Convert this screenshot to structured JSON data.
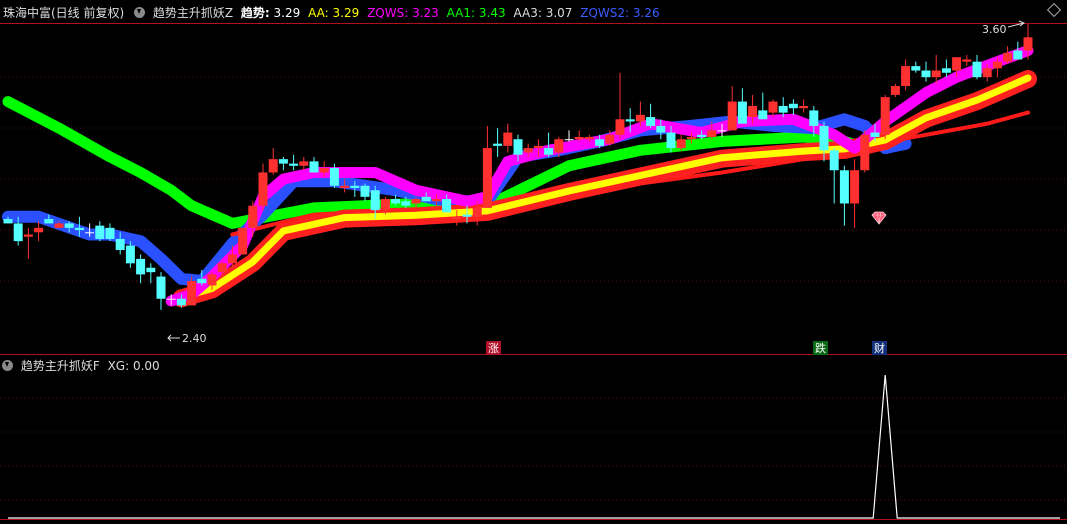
{
  "header": {
    "title": "珠海中富(日线 前复权)",
    "indicator": "趋势主升抓妖Z",
    "values": [
      {
        "label": "趋势:",
        "value": "3.29",
        "color": "#ffffff"
      },
      {
        "label": "AA:",
        "value": "3.29",
        "color": "#ffff00"
      },
      {
        "label": "ZQWS:",
        "value": "3.23",
        "color": "#ff00ff"
      },
      {
        "label": "AA1:",
        "value": "3.43",
        "color": "#00ff00"
      },
      {
        "label": "AA3:",
        "value": "3.07",
        "color": "#dddddd"
      },
      {
        "label": "ZQWS2:",
        "value": "3.26",
        "color": "#3a5cff"
      }
    ]
  },
  "lower": {
    "indicator": "趋势主升抓妖F",
    "value_label": "XG:",
    "value": "0.00"
  },
  "annotations": {
    "high": "3.60",
    "low": "2.40",
    "signals": [
      {
        "text": "涨",
        "bg": "#b0102a"
      },
      {
        "text": "跌",
        "bg": "#0c6a16"
      },
      {
        "text": "财",
        "bg": "#12307a"
      }
    ]
  },
  "chart_data": {
    "type": "candlestick",
    "price_range": [
      2.33,
      3.72
    ],
    "colors": {
      "up": "#ff3030",
      "down": "#54ffff",
      "flat": "#ffffff"
    },
    "candles": [
      [
        2.84,
        2.85,
        2.84,
        2.82
      ],
      [
        2.82,
        2.85,
        2.72,
        2.74
      ],
      [
        2.76,
        2.8,
        2.66,
        2.77
      ],
      [
        2.78,
        2.83,
        2.74,
        2.8
      ],
      [
        2.84,
        2.86,
        2.83,
        2.82
      ],
      [
        2.8,
        2.83,
        2.8,
        2.82
      ],
      [
        2.82,
        2.83,
        2.78,
        2.8
      ],
      [
        2.8,
        2.85,
        2.76,
        2.79
      ],
      [
        2.78,
        2.82,
        2.76,
        2.78
      ],
      [
        2.81,
        2.83,
        2.74,
        2.75
      ],
      [
        2.8,
        2.82,
        2.74,
        2.75
      ],
      [
        2.75,
        2.78,
        2.68,
        2.7
      ],
      [
        2.72,
        2.74,
        2.62,
        2.64
      ],
      [
        2.66,
        2.68,
        2.55,
        2.59
      ],
      [
        2.62,
        2.64,
        2.55,
        2.6
      ],
      [
        2.58,
        2.6,
        2.43,
        2.48
      ],
      [
        2.48,
        2.5,
        2.45,
        2.48
      ],
      [
        2.48,
        2.5,
        2.44,
        2.45
      ],
      [
        2.45,
        2.58,
        2.45,
        2.56
      ],
      [
        2.57,
        2.61,
        2.54,
        2.55
      ],
      [
        2.54,
        2.6,
        2.52,
        2.59
      ],
      [
        2.6,
        2.65,
        2.58,
        2.64
      ],
      [
        2.64,
        2.72,
        2.62,
        2.68
      ],
      [
        2.68,
        2.8,
        2.68,
        2.8
      ],
      [
        2.8,
        2.92,
        2.76,
        2.9
      ],
      [
        2.9,
        3.09,
        2.88,
        3.05
      ],
      [
        3.05,
        3.16,
        3.04,
        3.11
      ],
      [
        3.11,
        3.12,
        3.06,
        3.09
      ],
      [
        3.09,
        3.13,
        3.06,
        3.08
      ],
      [
        3.08,
        3.12,
        3.06,
        3.1
      ],
      [
        3.1,
        3.12,
        3.05,
        3.05
      ],
      [
        3.05,
        3.1,
        3.03,
        3.07
      ],
      [
        3.07,
        3.09,
        2.98,
        2.99
      ],
      [
        2.98,
        3.02,
        2.96,
        2.99
      ],
      [
        2.99,
        3.01,
        2.94,
        2.98
      ],
      [
        2.99,
        3.0,
        2.92,
        2.94
      ],
      [
        2.97,
        2.99,
        2.84,
        2.88
      ],
      [
        2.88,
        2.94,
        2.86,
        2.93
      ],
      [
        2.93,
        2.95,
        2.9,
        2.91
      ],
      [
        2.92,
        2.94,
        2.89,
        2.9
      ],
      [
        2.91,
        2.94,
        2.89,
        2.93
      ],
      [
        2.94,
        2.96,
        2.92,
        2.92
      ],
      [
        2.92,
        2.95,
        2.9,
        2.93
      ],
      [
        2.93,
        2.95,
        2.87,
        2.87
      ],
      [
        2.84,
        2.88,
        2.81,
        2.85
      ],
      [
        2.86,
        2.9,
        2.82,
        2.85
      ],
      [
        2.85,
        2.92,
        2.81,
        2.89
      ],
      [
        2.89,
        3.26,
        2.89,
        3.16
      ],
      [
        3.18,
        3.25,
        3.12,
        3.17
      ],
      [
        3.17,
        3.27,
        3.14,
        3.23
      ],
      [
        3.2,
        3.22,
        3.1,
        3.13
      ],
      [
        3.14,
        3.18,
        3.12,
        3.16
      ],
      [
        3.16,
        3.2,
        3.12,
        3.17
      ],
      [
        3.16,
        3.23,
        3.12,
        3.13
      ],
      [
        3.14,
        3.21,
        3.12,
        3.2
      ],
      [
        3.2,
        3.24,
        3.19,
        3.2
      ],
      [
        3.2,
        3.24,
        3.19,
        3.21
      ],
      [
        3.2,
        3.22,
        3.19,
        3.21
      ],
      [
        3.2,
        3.22,
        3.16,
        3.17
      ],
      [
        3.18,
        3.24,
        3.17,
        3.22
      ],
      [
        3.22,
        3.5,
        3.2,
        3.29
      ],
      [
        3.29,
        3.34,
        3.23,
        3.28
      ],
      [
        3.28,
        3.37,
        3.26,
        3.31
      ],
      [
        3.3,
        3.36,
        3.25,
        3.26
      ],
      [
        3.26,
        3.29,
        3.2,
        3.23
      ],
      [
        3.23,
        3.26,
        3.14,
        3.16
      ],
      [
        3.16,
        3.22,
        3.15,
        3.2
      ],
      [
        3.2,
        3.23,
        3.18,
        3.21
      ],
      [
        3.22,
        3.24,
        3.2,
        3.21
      ],
      [
        3.21,
        3.28,
        3.2,
        3.24
      ],
      [
        3.24,
        3.27,
        3.21,
        3.24
      ],
      [
        3.24,
        3.44,
        3.24,
        3.37
      ],
      [
        3.37,
        3.43,
        3.31,
        3.27
      ],
      [
        3.3,
        3.4,
        3.27,
        3.35
      ],
      [
        3.33,
        3.41,
        3.31,
        3.29
      ],
      [
        3.32,
        3.38,
        3.3,
        3.37
      ],
      [
        3.35,
        3.39,
        3.3,
        3.32
      ],
      [
        3.36,
        3.38,
        3.31,
        3.34
      ],
      [
        3.34,
        3.38,
        3.32,
        3.35
      ],
      [
        3.33,
        3.35,
        3.21,
        3.26
      ],
      [
        3.26,
        3.28,
        3.1,
        3.15
      ],
      [
        3.15,
        3.16,
        2.91,
        3.06
      ],
      [
        3.06,
        3.08,
        2.81,
        2.91
      ],
      [
        2.91,
        3.11,
        2.8,
        3.06
      ],
      [
        3.06,
        3.24,
        3.05,
        3.22
      ],
      [
        3.23,
        3.27,
        3.19,
        3.21
      ],
      [
        3.22,
        3.4,
        3.2,
        3.39
      ],
      [
        3.4,
        3.45,
        3.39,
        3.44
      ],
      [
        3.44,
        3.56,
        3.42,
        3.53
      ],
      [
        3.53,
        3.55,
        3.5,
        3.51
      ],
      [
        3.51,
        3.55,
        3.46,
        3.48
      ],
      [
        3.48,
        3.58,
        3.45,
        3.51
      ],
      [
        3.52,
        3.56,
        3.48,
        3.5
      ],
      [
        3.51,
        3.57,
        3.48,
        3.57
      ],
      [
        3.55,
        3.58,
        3.53,
        3.56
      ],
      [
        3.55,
        3.58,
        3.47,
        3.48
      ],
      [
        3.48,
        3.54,
        3.46,
        3.52
      ],
      [
        3.52,
        3.57,
        3.48,
        3.55
      ],
      [
        3.55,
        3.62,
        3.54,
        3.59
      ],
      [
        3.6,
        3.64,
        3.56,
        3.56
      ],
      [
        3.6,
        3.72,
        3.56,
        3.66
      ]
    ],
    "series": [
      {
        "name": "AA",
        "color": "#ffff00",
        "points": [
          [
            17,
            2.5
          ],
          [
            20,
            2.54
          ],
          [
            24,
            2.66
          ],
          [
            27,
            2.8
          ],
          [
            33,
            2.86
          ],
          [
            40,
            2.87
          ],
          [
            47,
            2.89
          ],
          [
            55,
            2.98
          ],
          [
            62,
            3.05
          ],
          [
            70,
            3.13
          ],
          [
            78,
            3.16
          ],
          [
            82,
            3.17
          ],
          [
            86,
            3.21
          ],
          [
            90,
            3.31
          ],
          [
            95,
            3.39
          ],
          [
            100,
            3.49
          ]
        ]
      },
      {
        "name": "ZQWS",
        "color": "#ff00ff",
        "points": [
          [
            16,
            2.47
          ],
          [
            18,
            2.5
          ],
          [
            20,
            2.58
          ],
          [
            23,
            2.72
          ],
          [
            25,
            2.94
          ],
          [
            27,
            3.02
          ],
          [
            30,
            3.05
          ],
          [
            36,
            3.05
          ],
          [
            40,
            2.97
          ],
          [
            45,
            2.92
          ],
          [
            47,
            2.94
          ],
          [
            49,
            3.1
          ],
          [
            53,
            3.15
          ],
          [
            59,
            3.2
          ],
          [
            63,
            3.27
          ],
          [
            68,
            3.23
          ],
          [
            72,
            3.28
          ],
          [
            77,
            3.29
          ],
          [
            81,
            3.22
          ],
          [
            83,
            3.16
          ],
          [
            86,
            3.28
          ],
          [
            90,
            3.41
          ],
          [
            93,
            3.48
          ],
          [
            97,
            3.55
          ],
          [
            100,
            3.6
          ]
        ]
      },
      {
        "name": "AA1",
        "color": "#00ff00",
        "points": [
          [
            0,
            3.37
          ],
          [
            5,
            3.25
          ],
          [
            10,
            3.12
          ],
          [
            13,
            3.05
          ],
          [
            16,
            2.97
          ],
          [
            18,
            2.9
          ],
          [
            22,
            2.82
          ],
          [
            30,
            2.89
          ],
          [
            40,
            2.91
          ],
          [
            47,
            2.9
          ],
          [
            55,
            3.08
          ],
          [
            62,
            3.15
          ],
          [
            70,
            3.19
          ],
          [
            78,
            3.21
          ],
          [
            82,
            3.19
          ],
          [
            84,
            3.16
          ]
        ]
      },
      {
        "name": "AA3",
        "color": "#2a50ff",
        "points": [
          [
            0,
            2.85
          ],
          [
            3,
            2.85
          ],
          [
            8,
            2.77
          ],
          [
            10,
            2.77
          ],
          [
            13,
            2.74
          ],
          [
            15,
            2.66
          ],
          [
            17,
            2.57
          ],
          [
            19,
            2.56
          ],
          [
            22,
            2.73
          ],
          [
            25,
            2.86
          ],
          [
            28,
            3.01
          ],
          [
            32,
            3.01
          ],
          [
            38,
            2.97
          ],
          [
            42,
            2.93
          ],
          [
            45,
            2.92
          ],
          [
            47,
            2.92
          ],
          [
            50,
            3.12
          ],
          [
            54,
            3.15
          ],
          [
            58,
            3.19
          ],
          [
            62,
            3.24
          ],
          [
            67,
            3.26
          ],
          [
            71,
            3.28
          ],
          [
            75,
            3.26
          ],
          [
            79,
            3.25
          ],
          [
            82,
            3.29
          ],
          [
            84,
            3.26
          ],
          [
            86,
            3.16
          ],
          [
            88,
            3.18
          ]
        ]
      },
      {
        "name": "ZQWS2",
        "color": "#ff1a1a",
        "points": [
          [
            22,
            2.77
          ],
          [
            30,
            2.86
          ],
          [
            38,
            2.88
          ],
          [
            47,
            2.89
          ],
          [
            55,
            2.95
          ],
          [
            62,
            3.0
          ],
          [
            70,
            3.05
          ],
          [
            78,
            3.11
          ],
          [
            84,
            3.17
          ],
          [
            90,
            3.22
          ],
          [
            96,
            3.27
          ],
          [
            100,
            3.32
          ]
        ]
      }
    ],
    "signals": [
      {
        "name": "XG",
        "color": "#ffffff",
        "index": 86,
        "value": 1
      }
    ]
  }
}
